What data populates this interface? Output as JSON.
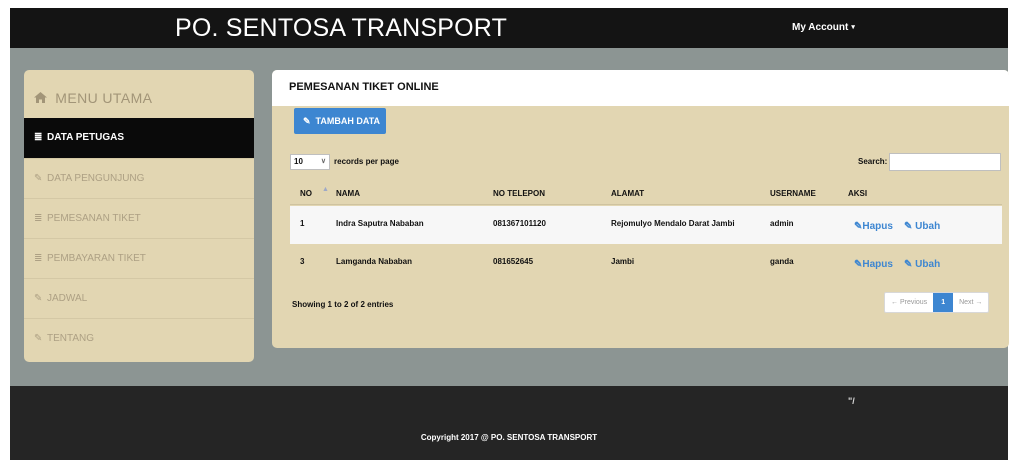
{
  "header": {
    "brand": "PO. SENTOSA TRANSPORT",
    "account_label": "My Account",
    "account_caret": "▾"
  },
  "sidebar": {
    "heading": "MENU UTAMA",
    "heading_icon": "home-icon",
    "items": [
      {
        "label": "DATA PETUGAS",
        "icon": "list-icon",
        "glyph": "≣",
        "active": true
      },
      {
        "label": "DATA PENGUNJUNG",
        "icon": "pencil-icon",
        "glyph": "✎",
        "active": false
      },
      {
        "label": "PEMESANAN TIKET",
        "icon": "list-icon",
        "glyph": "≣",
        "active": false
      },
      {
        "label": "PEMBAYARAN TIKET",
        "icon": "list-icon",
        "glyph": "≣",
        "active": false
      },
      {
        "label": "JADWAL",
        "icon": "pencil-icon",
        "glyph": "✎",
        "active": false
      },
      {
        "label": "TENTANG",
        "icon": "pencil-icon",
        "glyph": "✎",
        "active": false
      }
    ]
  },
  "panel": {
    "title": "PEMESANAN TIKET ONLINE",
    "add_button": "TAMBAH DATA",
    "length_value": "10",
    "length_label": "records per page",
    "search_label": "Search:",
    "search_value": ""
  },
  "table": {
    "columns": [
      "NO",
      "NAMA",
      "NO TELEPON",
      "ALAMAT",
      "USERNAME",
      "AKSI"
    ],
    "rows": [
      {
        "no": "1",
        "nama": "Indra Saputra Nababan",
        "telepon": "081367101120",
        "alamat": "Rejomulyo Mendalo Darat Jambi",
        "username": "admin"
      },
      {
        "no": "3",
        "nama": "Lamganda Nababan",
        "telepon": "081652645",
        "alamat": "Jambi",
        "username": "ganda"
      }
    ],
    "delete_label": "Hapus",
    "edit_label": "Ubah"
  },
  "pagination": {
    "info": "Showing 1 to 2 of 2 entries",
    "previous": "← Previous",
    "current": "1",
    "next": "Next →"
  },
  "footer": {
    "mark": "\"/",
    "copyright": "Copyright 2017 @ PO. SENTOSA TRANSPORT"
  },
  "colors": {
    "topbar": "#141414",
    "background": "#8c9593",
    "panel": "#e2d6b2",
    "accent": "#3d86d1",
    "footer": "#252525"
  }
}
